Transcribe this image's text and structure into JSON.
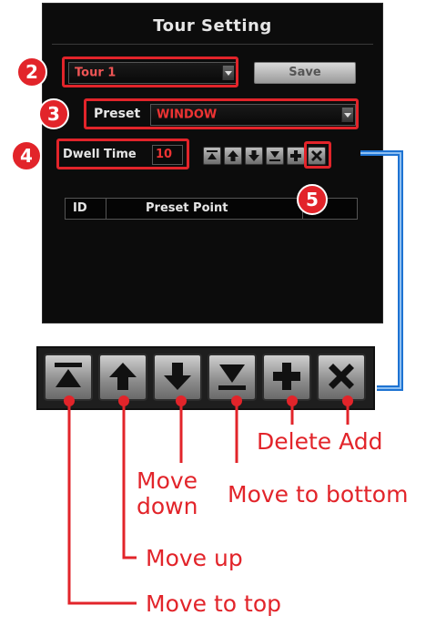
{
  "panel": {
    "title": "Tour Setting",
    "tour_select_value": "Tour 1",
    "save_label": "Save",
    "preset_label": "Preset",
    "preset_value": "WINDOW",
    "dwell_label": "Dwell Time",
    "dwell_value": "10",
    "table_headers": [
      "ID",
      "Preset Point"
    ]
  },
  "badges": [
    "2",
    "3",
    "4",
    "5"
  ],
  "toolbar_icons": [
    "move-to-top-icon",
    "move-up-icon",
    "move-down-icon",
    "move-to-bottom-icon",
    "add-icon",
    "delete-icon"
  ],
  "callouts": {
    "delete_add": "Delete Add",
    "move_down": "Move\ndown",
    "move_to_bottom": "Move to bottom",
    "move_up": "Move up",
    "move_to_top": "Move to top"
  },
  "colors": {
    "accent_red": "#e2242a",
    "connector_blue": "#1e73d2",
    "panel_bg": "#0c0c0c"
  }
}
